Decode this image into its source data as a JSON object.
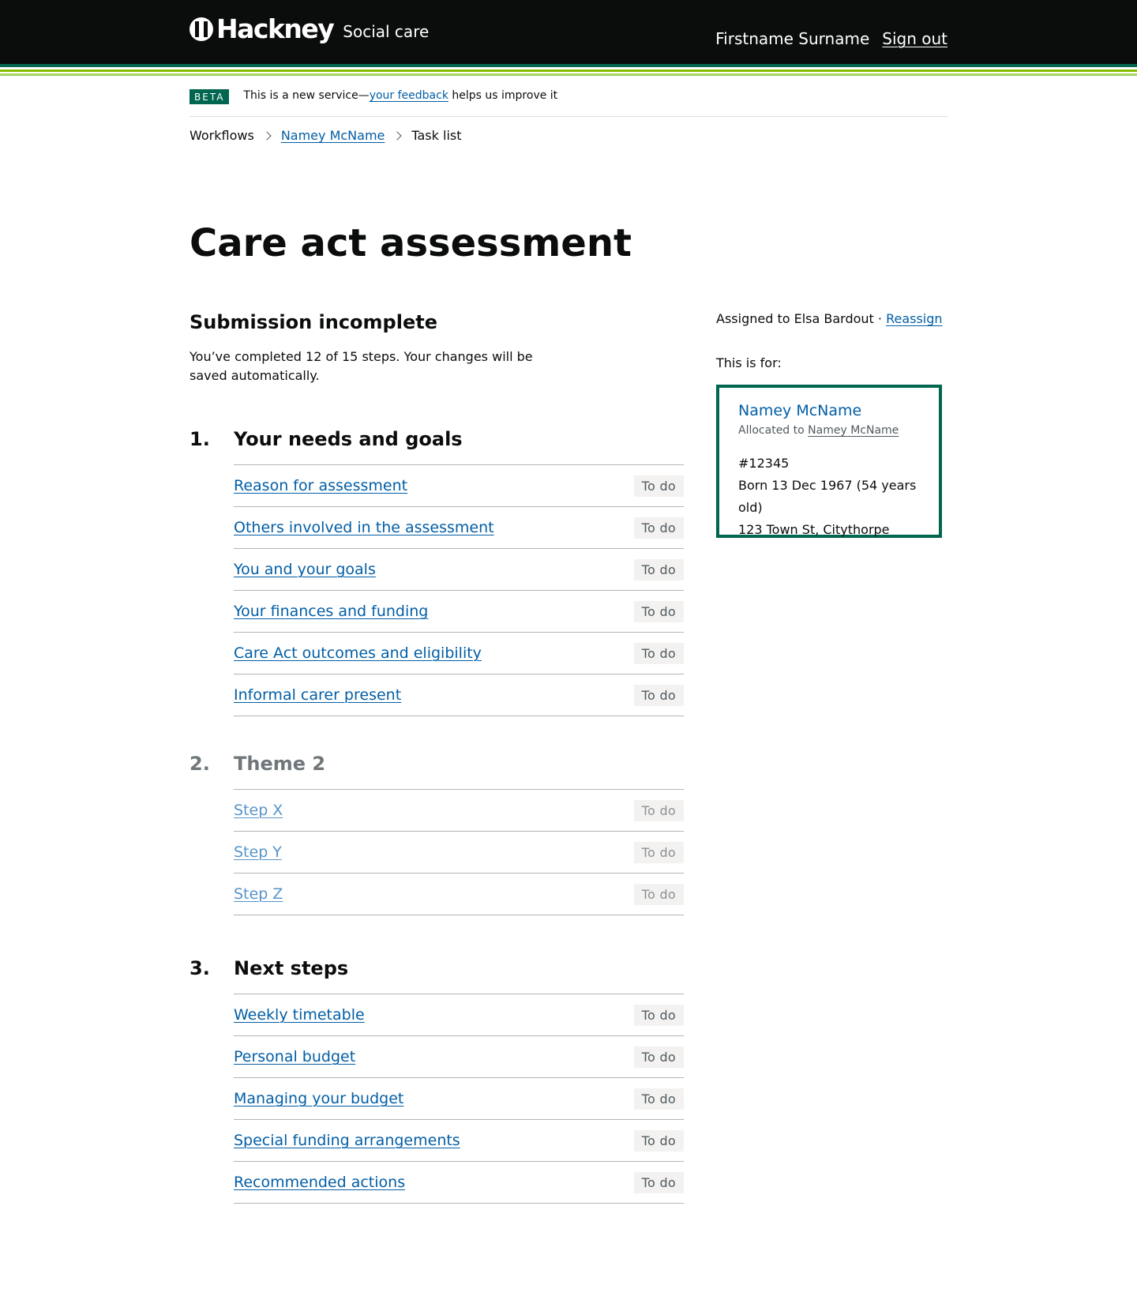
{
  "header": {
    "logo_text": "Hackney",
    "service_name": "Social care",
    "user_name": "Firstname Surname",
    "sign_out": "Sign out"
  },
  "phase_banner": {
    "tag": "BETA",
    "text_before": "This is a new service—",
    "link": "your feedback",
    "text_after": " helps us improve it"
  },
  "breadcrumb": {
    "items": [
      "Workflows",
      "Namey McName",
      "Task list"
    ]
  },
  "page": {
    "title": "Care act assessment",
    "status_title": "Submission incomplete",
    "status_text": "You’ve completed 12 of 15 steps. Your changes will be saved automatically."
  },
  "sections": [
    {
      "number": "1.",
      "title": "Your needs and goals",
      "tasks": [
        {
          "label": "Reason for assessment",
          "status": "To do"
        },
        {
          "label": "Others involved in the assessment",
          "status": "To do"
        },
        {
          "label": "You and your goals",
          "status": "To do"
        },
        {
          "label": "Your finances and funding",
          "status": "To do"
        },
        {
          "label": "Care Act outcomes and eligibility",
          "status": "To do"
        },
        {
          "label": "Informal carer present",
          "status": "To do"
        }
      ]
    },
    {
      "number": "2.",
      "title": "Theme 2",
      "tasks": [
        {
          "label": "Step X",
          "status": "To do"
        },
        {
          "label": "Step Y",
          "status": "To do"
        },
        {
          "label": "Step Z",
          "status": "To do"
        }
      ]
    },
    {
      "number": "3.",
      "title": "Next steps",
      "tasks": [
        {
          "label": "Weekly timetable",
          "status": "To do"
        },
        {
          "label": "Personal budget",
          "status": "To do"
        },
        {
          "label": "Managing your budget",
          "status": "To do"
        },
        {
          "label": "Special funding arrangements",
          "status": "To do"
        },
        {
          "label": "Recommended actions",
          "status": "To do"
        }
      ]
    }
  ],
  "aside": {
    "assigned_text": "Assigned to Elsa Bardout · ",
    "reassign": "Reassign",
    "for_label": "This is for:",
    "person": {
      "name": "Namey McName",
      "allocated_prefix": "Allocated to ",
      "allocated_to": "Namey McName",
      "id": "#12345",
      "born": "Born 13 Dec 1967 (54 years old)",
      "address": "123 Town St, Citythorpe"
    }
  },
  "colors": {
    "brand_green": "#00664f",
    "link_blue": "#025ea6",
    "header_bg": "#0b0c0c"
  }
}
